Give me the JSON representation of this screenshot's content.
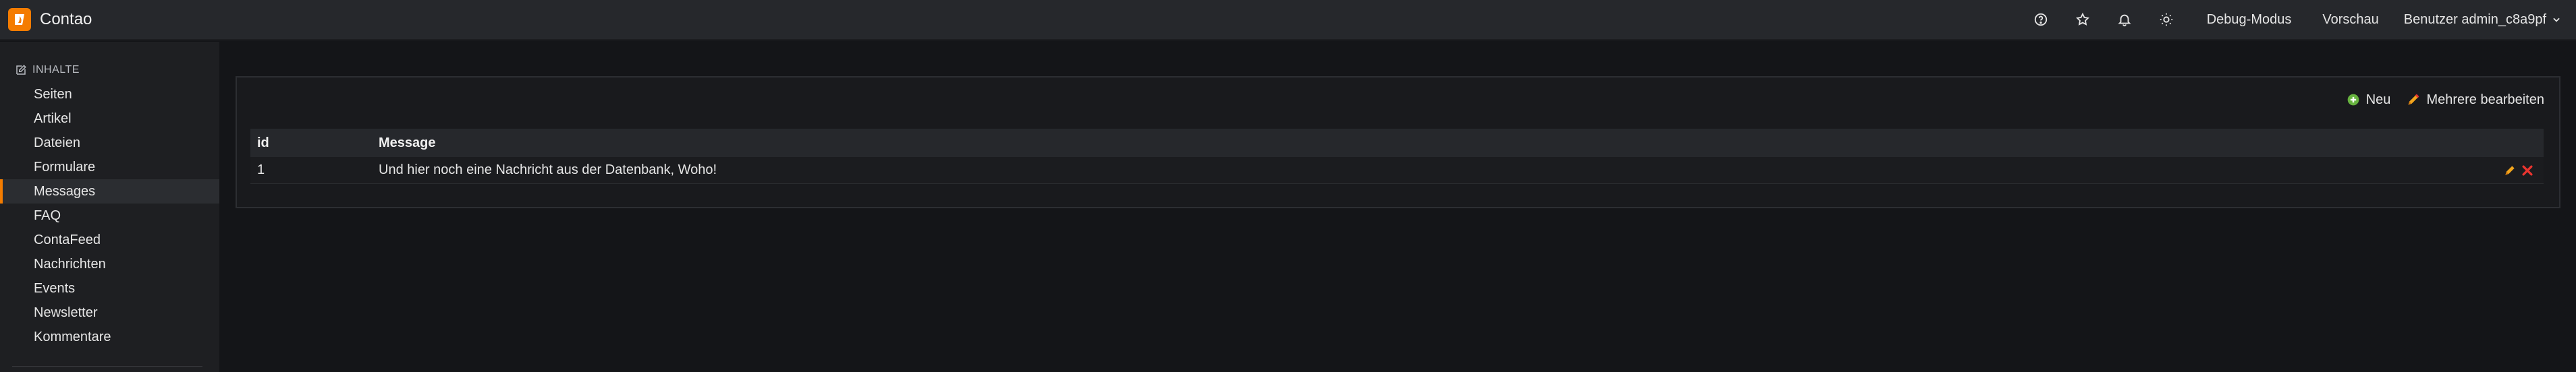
{
  "header": {
    "app_name": "Contao",
    "icons": [
      "help-icon",
      "star-icon",
      "bell-icon",
      "sun-icon"
    ],
    "debug_label": "Debug-Modus",
    "preview_label": "Vorschau",
    "user_label": "Benutzer admin_c8a9pf"
  },
  "sidebar": {
    "section_title": "INHALTE",
    "items": [
      {
        "label": "Seiten"
      },
      {
        "label": "Artikel"
      },
      {
        "label": "Dateien"
      },
      {
        "label": "Formulare"
      },
      {
        "label": "Messages",
        "active": true
      },
      {
        "label": "FAQ"
      },
      {
        "label": "ContaFeed"
      },
      {
        "label": "Nachrichten"
      },
      {
        "label": "Events"
      },
      {
        "label": "Newsletter"
      },
      {
        "label": "Kommentare"
      }
    ]
  },
  "main": {
    "toolbar": {
      "new_label": "Neu",
      "edit_multiple_label": "Mehrere bearbeiten"
    },
    "table": {
      "columns": [
        "id",
        "Message"
      ],
      "rows": [
        {
          "id": "1",
          "message": "Und hier noch eine Nachricht aus der Datenbank, Woho!"
        }
      ]
    }
  },
  "colors": {
    "accent": "#f47c00",
    "header_bg": "#26282c",
    "sidebar_bg": "#1e1f22",
    "page_bg": "#141518",
    "new_icon": "#67b33f",
    "delete_icon": "#e8342f"
  }
}
